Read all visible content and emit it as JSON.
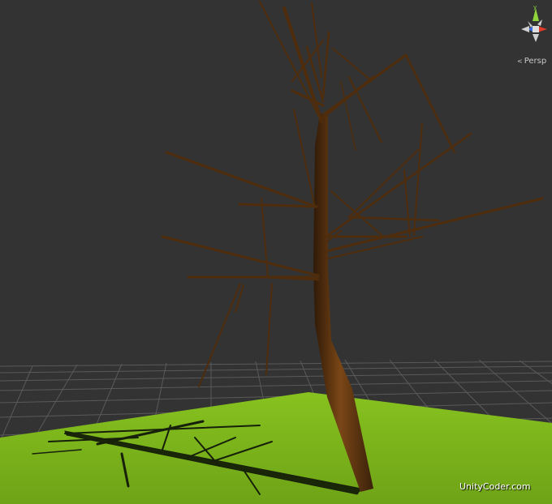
{
  "scene_view": {
    "projection_label": "Persp",
    "projection_glyph": "<",
    "axis_gizmo": "scene-orientation-gizmo",
    "watermark": "UnityCoder.com"
  },
  "colors": {
    "background": "#333333",
    "grid_line": "#5a5a5a",
    "ground": "#7db51d",
    "ground_shadow": "#1c2a07",
    "trunk": "#6b3d14",
    "trunk_dark": "#2f1a08",
    "branch": "#5a3310",
    "gizmo_x": "#e03a2a",
    "gizmo_y": "#8fd43a",
    "gizmo_z": "#3a6ae0"
  },
  "tree": {
    "icon": "bare-tree-mesh",
    "shadow_icon": "tree-shadow"
  }
}
